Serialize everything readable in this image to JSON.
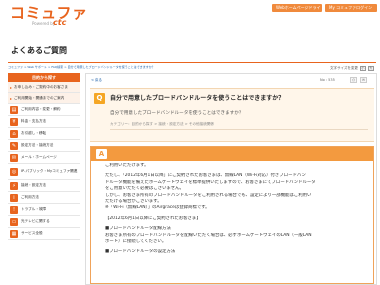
{
  "header": {
    "logo_main": "コミュファ",
    "logo_sub": "Powered by",
    "logo_ctc": "ctc",
    "links": [
      "Webホームページドライ",
      "My コミュファログイン"
    ]
  },
  "page_title": "よくあるご質問",
  "breadcrumb": "コミュファ > Web サポート > FAQ検索 > 自分で用意したブロードバンドルータを使うことはできますか？",
  "tools": {
    "label": "文字サイズを変更",
    "small": "小",
    "large": "大"
  },
  "sidebar": {
    "heading": "目的から探す",
    "items": [
      {
        "label": "お申し込み・ご契約中のお客さま",
        "icon": "arrow-icon"
      },
      {
        "label": "ご利用開始・開通までのご案内",
        "icon": "arrow-icon"
      },
      {
        "label": "ご利用内容・変更・解約",
        "icon": "doc-icon"
      },
      {
        "label": "料金・支払方法",
        "icon": "yen-icon"
      },
      {
        "label": "お引越し・移転",
        "icon": "house-icon"
      },
      {
        "label": "設定方法・接続方法",
        "icon": "tool-icon"
      },
      {
        "label": "メール・ホームページ",
        "icon": "mail-icon"
      },
      {
        "label": "IP-パブリック・Myコミュファ関連",
        "icon": "network-icon"
      },
      {
        "label": "接続・設定方法",
        "icon": "plug-icon"
      },
      {
        "label": "ご利用方法",
        "icon": "info-icon"
      },
      {
        "label": "トラブル・故障",
        "icon": "warning-icon"
      },
      {
        "label": "光テレビに関する",
        "icon": "tv-icon"
      },
      {
        "label": "サービス全般",
        "icon": "grid-icon"
      }
    ]
  },
  "content": {
    "back": "< 戻る",
    "no_label": "No : 535",
    "question": {
      "title": "自分で用意したブロードバンドルータを使うことはできますか？",
      "body": "自分で用意したブロードバンドルータを使うことはできますか？",
      "category": "カテゴリー：目的から探す > 接続・設定方法 > その他接続関係"
    },
    "answer_lines": [
      "ご利用いただけます。",
      "",
      "ただし、「2012年6月1日以降」にご契約されたお客さまは、無線LAN（Wi-Fi対応）付きブロードバン",
      "ドルータ機能を備えたホームゲートウェイを標準提供いたしますので、お客さまにてブロードバンドルータ",
      "をご用意いただく必要はございません。",
      "しかし、お客さま所有のブロードバンドルータをご利用される場合でも、設定により一部機能はご利用い",
      "ただける場合がございます。",
      "※「Wi-Fi（無線LAN）」のAirgraceは登録商標です。",
      "",
      "【2012年6月1日以降にご契約されたお客さま】",
      "",
      "■ブロードバンドルータ配線方法",
      "お客さま所有のブロードバンドルータを配線いただく場合は、必ずホームゲートウェイのLAN（一般LAN",
      "ポート）に接続してください。",
      "",
      "■ブロードバンドルータの設定方法"
    ]
  }
}
